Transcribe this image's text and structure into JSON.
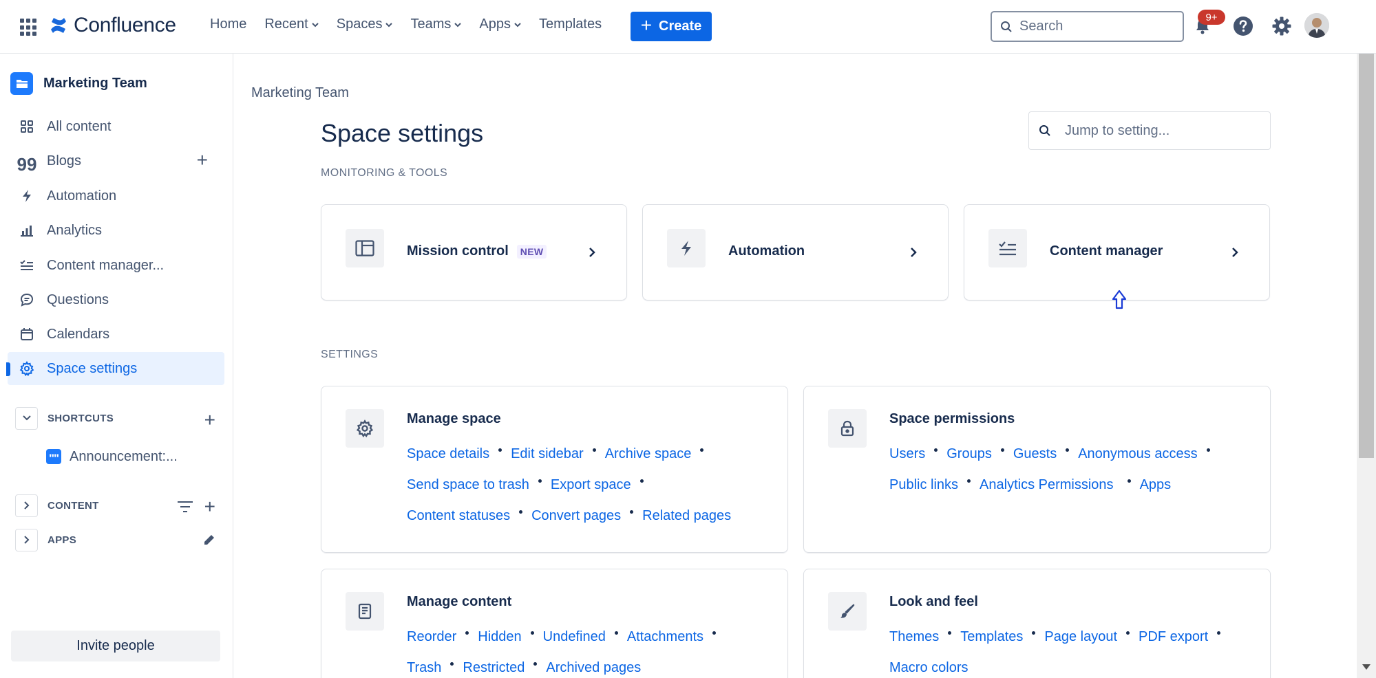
{
  "topnav": {
    "logo_text": "Confluence",
    "links": [
      {
        "label": "Home",
        "has_menu": false
      },
      {
        "label": "Recent",
        "has_menu": true
      },
      {
        "label": "Spaces",
        "has_menu": true
      },
      {
        "label": "Teams",
        "has_menu": true
      },
      {
        "label": "Apps",
        "has_menu": true
      },
      {
        "label": "Templates",
        "has_menu": false
      }
    ],
    "create_label": "Create",
    "search_placeholder": "Search",
    "notifications_badge": "9+",
    "icons": [
      "app-switcher-icon",
      "bell-icon",
      "help-icon",
      "settings-icon",
      "avatar"
    ]
  },
  "sidebar": {
    "space_name": "Marketing Team",
    "items": [
      {
        "label": "All content",
        "icon": "grid-icon",
        "active": false
      },
      {
        "label": "Blogs",
        "icon": "quote-icon",
        "active": false
      },
      {
        "label": "Automation",
        "icon": "lightning-icon",
        "active": false
      },
      {
        "label": "Analytics",
        "icon": "bar-chart-icon",
        "active": false
      },
      {
        "label": "Content manager...",
        "icon": "checklist-icon",
        "active": false
      },
      {
        "label": "Questions",
        "icon": "speech-bubble-icon",
        "active": false
      },
      {
        "label": "Calendars",
        "icon": "calendar-icon",
        "active": false
      },
      {
        "label": "Space settings",
        "icon": "gear-icon",
        "active": true
      }
    ],
    "shortcuts_label": "SHORTCUTS",
    "shortcut_item": "Announcement:...",
    "content_label": "CONTENT",
    "apps_label": "APPS",
    "invite_label": "Invite people"
  },
  "main": {
    "breadcrumb": "Marketing Team",
    "title": "Space settings",
    "jump_placeholder": "Jump to setting...",
    "monitoring_heading": "MONITORING & TOOLS",
    "tools": [
      {
        "label": "Mission control",
        "lozenge": "NEW",
        "icon": "panel-layout-icon"
      },
      {
        "label": "Automation",
        "lozenge": "",
        "icon": "lightning-icon"
      },
      {
        "label": "Content manager",
        "lozenge": "",
        "icon": "checklist-icon"
      }
    ],
    "settings_heading": "SETTINGS",
    "cards": [
      {
        "title": "Manage space",
        "icon": "gear-icon",
        "lines": [
          [
            "Space details",
            "Edit sidebar",
            "Archive space"
          ],
          [
            "Send space to trash",
            "Export space"
          ],
          [
            "Content statuses",
            "Convert pages",
            "Related pages"
          ]
        ]
      },
      {
        "title": "Space permissions",
        "icon": "lock-icon",
        "lines": [
          [
            "Users",
            "Groups",
            "Guests",
            "Anonymous access"
          ],
          [
            "Public links",
            "Analytics Permissions",
            "Apps"
          ]
        ]
      },
      {
        "title": "Manage content",
        "icon": "document-icon",
        "lines": [
          [
            "Reorder",
            "Hidden",
            "Undefined",
            "Attachments"
          ],
          [
            "Trash",
            "Restricted",
            "Archived pages"
          ]
        ]
      },
      {
        "title": "Look and feel",
        "icon": "paintbrush-icon",
        "lines": [
          [
            "Themes",
            "Templates",
            "Page layout",
            "PDF export"
          ],
          [
            "Macro colors"
          ]
        ]
      }
    ]
  },
  "colors": {
    "brand_blue": "#0c66e4",
    "text_primary": "#172b4d",
    "text_subtle": "#44546f",
    "active_bg": "#e9f2ff",
    "badge_red": "#c9372c",
    "lozenge_purple": "#5e4db2"
  }
}
